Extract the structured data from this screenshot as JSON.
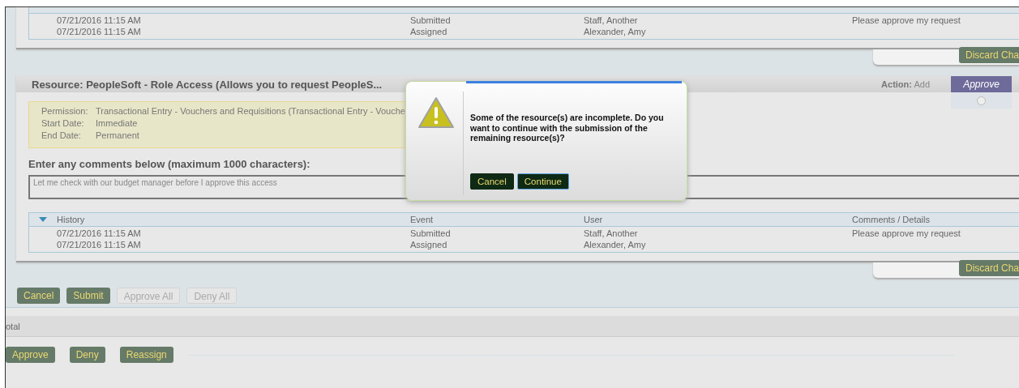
{
  "top_history": {
    "rows": [
      {
        "date": "07/21/2016 11:15 AM",
        "event": "Submitted",
        "user": "Staff, Another",
        "comments": "Please approve my request"
      },
      {
        "date": "07/21/2016 11:15 AM",
        "event": "Assigned",
        "user": "Alexander, Amy",
        "comments": ""
      }
    ]
  },
  "top_discard": "Discard Cha",
  "resource": {
    "title": "Resource: PeopleSoft - Role Access (Allows you to request PeopleS...",
    "action_label": "Action:",
    "action_value": "Add",
    "approve_header": "Approve",
    "approve_selected": false,
    "details": [
      {
        "label": "Permission:",
        "value": "Transactional Entry - Vouchers and Requisitions (Transactional Entry - Vouche"
      },
      {
        "label": "Start Date:",
        "value": "Immediate"
      },
      {
        "label": "End Date:",
        "value": "Permanent"
      }
    ],
    "comments_label": "Enter any comments below (maximum 1000 characters):",
    "comments_value": "Let me check with our budget manager before I approve this access",
    "history": {
      "columns": [
        "History",
        "Event",
        "User",
        "Comments / Details"
      ],
      "rows": [
        {
          "date": "07/21/2016 11:15 AM",
          "event": "Submitted",
          "user": "Staff, Another",
          "comments": "Please approve my request"
        },
        {
          "date": "07/21/2016 11:15 AM",
          "event": "Assigned",
          "user": "Alexander, Amy",
          "comments": ""
        }
      ]
    },
    "discard": "Discard Cha"
  },
  "actions": [
    {
      "label": "Cancel",
      "disabled": false
    },
    {
      "label": "Submit",
      "disabled": false
    },
    {
      "label": "Approve All",
      "disabled": true
    },
    {
      "label": "Deny All",
      "disabled": true
    }
  ],
  "footer": {
    "label": "otal",
    "buttons": [
      "Approve",
      "Deny",
      "Reassign"
    ]
  },
  "dialog": {
    "message": "Some of the resource(s) are incomplete. Do you want to continue with the submission of the remaining resource(s)?",
    "buttons": [
      {
        "label": "Cancel",
        "focused": false
      },
      {
        "label": "Continue",
        "focused": true
      }
    ]
  }
}
